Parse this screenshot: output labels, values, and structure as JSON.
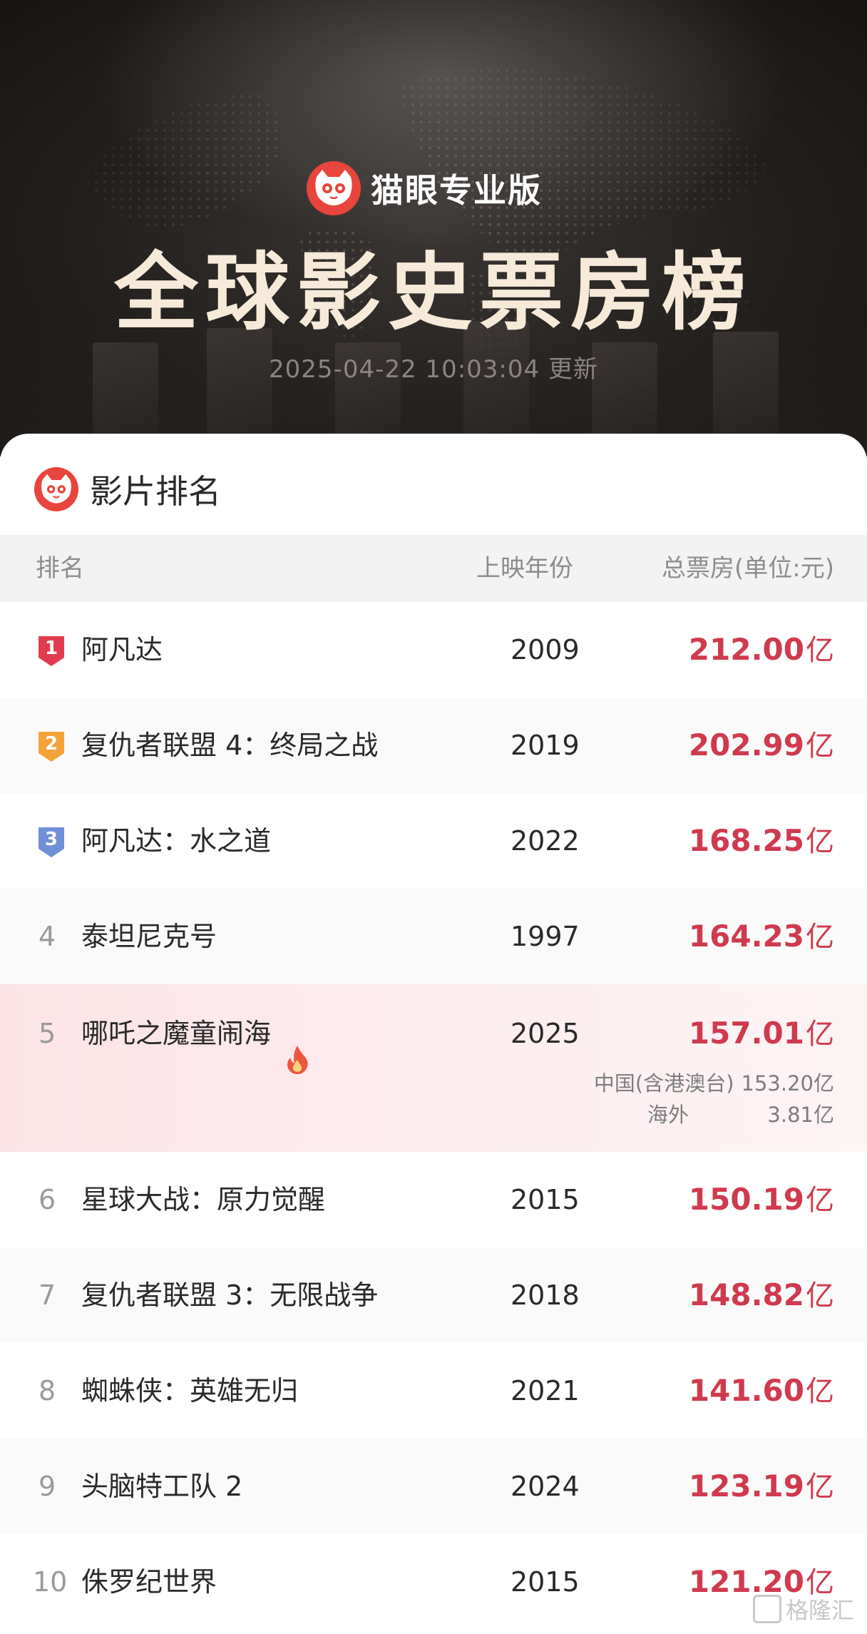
{
  "header": {
    "brand_name": "猫眼专业版",
    "title": "全球影史票房榜",
    "updated": "2025-04-22 10:03:04 更新"
  },
  "section": {
    "title": "影片排名"
  },
  "table": {
    "columns": {
      "rank": "排名",
      "year": "上映年份",
      "total": "总票房(单位:元)"
    },
    "rows": [
      {
        "rank": "1",
        "title": "阿凡达",
        "year": "2009",
        "gross": "212.00",
        "unit": "亿",
        "badge": "red"
      },
      {
        "rank": "2",
        "title": "复仇者联盟 4：终局之战",
        "year": "2019",
        "gross": "202.99",
        "unit": "亿",
        "badge": "orange"
      },
      {
        "rank": "3",
        "title": "阿凡达：水之道",
        "year": "2022",
        "gross": "168.25",
        "unit": "亿",
        "badge": "blue"
      },
      {
        "rank": "4",
        "title": "泰坦尼克号",
        "year": "1997",
        "gross": "164.23",
        "unit": "亿"
      },
      {
        "rank": "5",
        "title": "哪吒之魔童闹海",
        "year": "2025",
        "gross": "157.01",
        "unit": "亿",
        "hot": true,
        "breakdown": [
          {
            "label": "中国(含港澳台)",
            "value": "153.20亿"
          },
          {
            "label": "海外",
            "value": "3.81亿"
          }
        ]
      },
      {
        "rank": "6",
        "title": "星球大战：原力觉醒",
        "year": "2015",
        "gross": "150.19",
        "unit": "亿"
      },
      {
        "rank": "7",
        "title": "复仇者联盟 3：无限战争",
        "year": "2018",
        "gross": "148.82",
        "unit": "亿"
      },
      {
        "rank": "8",
        "title": "蜘蛛侠：英雄无归",
        "year": "2021",
        "gross": "141.60",
        "unit": "亿"
      },
      {
        "rank": "9",
        "title": "头脑特工队 2",
        "year": "2024",
        "gross": "123.19",
        "unit": "亿"
      },
      {
        "rank": "10",
        "title": "侏罗纪世界",
        "year": "2015",
        "gross": "121.20",
        "unit": "亿"
      }
    ]
  },
  "watermark": {
    "text": "格隆汇"
  },
  "colors": {
    "brand_red": "#e8453c",
    "gross_red": "#d03a4e",
    "badge_red": "#e23d4f",
    "badge_orange": "#f4a238",
    "badge_blue": "#6f8fd6",
    "highlight_bg": "#fde3e6"
  },
  "icons": {
    "logo": "cat-face-icon",
    "hot": "fire-icon"
  }
}
